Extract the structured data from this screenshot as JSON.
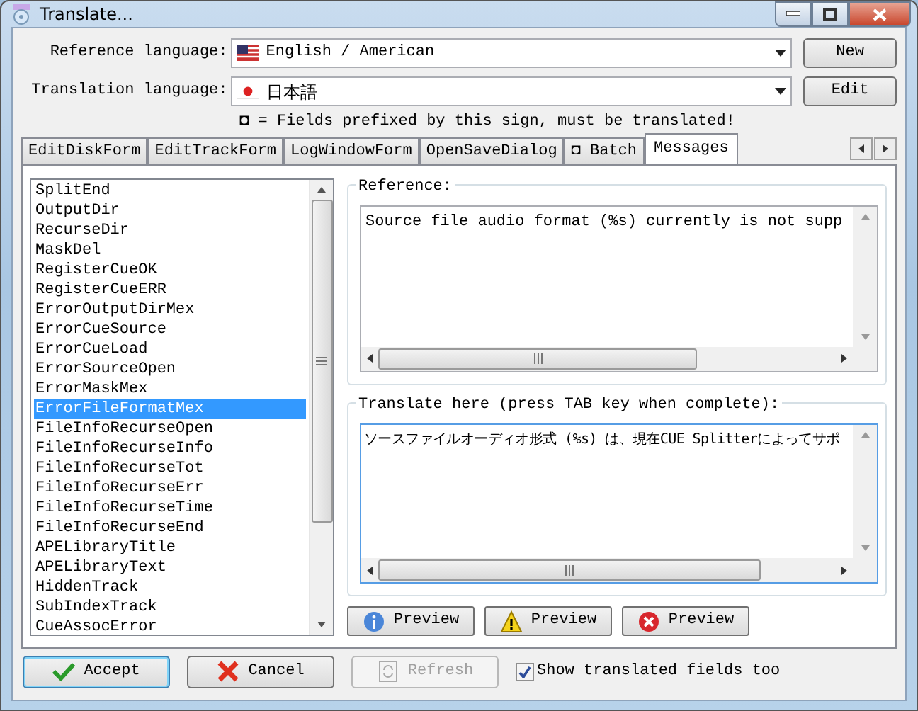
{
  "window": {
    "title": "Translate..."
  },
  "languages": [
    {
      "label": "Reference language:",
      "value": "English / American",
      "kind": "us"
    },
    {
      "label": "Translation language:",
      "value": "日本語",
      "kind": "jp"
    }
  ],
  "side_buttons": [
    "New",
    "Edit"
  ],
  "note": "◘ = Fields prefixed by this sign, must be translated!",
  "tabs": [
    {
      "label": "EditDiskForm",
      "selected": false
    },
    {
      "label": "EditTrackForm",
      "selected": false
    },
    {
      "label": "LogWindowForm",
      "selected": false
    },
    {
      "label": "OpenSaveDialog",
      "selected": false
    },
    {
      "label": "◘ Batch",
      "selected": false
    },
    {
      "label": "Messages",
      "selected": true
    }
  ],
  "keys": [
    {
      "label": "SplitEnd",
      "selected": false
    },
    {
      "label": "OutputDir",
      "selected": false
    },
    {
      "label": "RecurseDir",
      "selected": false
    },
    {
      "label": "MaskDel",
      "selected": false
    },
    {
      "label": "RegisterCueOK",
      "selected": false
    },
    {
      "label": "RegisterCueERR",
      "selected": false
    },
    {
      "label": "ErrorOutputDirMex",
      "selected": false
    },
    {
      "label": "ErrorCueSource",
      "selected": false
    },
    {
      "label": "ErrorCueLoad",
      "selected": false
    },
    {
      "label": "ErrorSourceOpen",
      "selected": false
    },
    {
      "label": "ErrorMaskMex",
      "selected": false
    },
    {
      "label": "ErrorFileFormatMex",
      "selected": true
    },
    {
      "label": "FileInfoRecurseOpen",
      "selected": false
    },
    {
      "label": "FileInfoRecurseInfo",
      "selected": false
    },
    {
      "label": "FileInfoRecurseTot",
      "selected": false
    },
    {
      "label": "FileInfoRecurseErr",
      "selected": false
    },
    {
      "label": "FileInfoRecurseTime",
      "selected": false
    },
    {
      "label": "FileInfoRecurseEnd",
      "selected": false
    },
    {
      "label": "APELibraryTitle",
      "selected": false
    },
    {
      "label": "APELibraryText",
      "selected": false
    },
    {
      "label": "HiddenTrack",
      "selected": false
    },
    {
      "label": "SubIndexTrack",
      "selected": false
    },
    {
      "label": "CueAssocError",
      "selected": false
    }
  ],
  "reference": {
    "label": "Reference:",
    "text": "Source file audio format (%s) currently is not supp"
  },
  "translation": {
    "label": "Translate here (press TAB key when complete):",
    "text": "ソースファイルオーディオ形式 (%s) は、現在CUE Splitterによってサポ"
  },
  "preview_buttons": [
    {
      "kind": "info",
      "label": "Preview"
    },
    {
      "kind": "warning",
      "label": "Preview"
    },
    {
      "kind": "error",
      "label": "Preview"
    }
  ],
  "footer_buttons": [
    {
      "kind": "accept",
      "label": "Accept",
      "disabled": false
    },
    {
      "kind": "cancel",
      "label": "Cancel",
      "disabled": false
    },
    {
      "kind": "refresh",
      "label": "Refresh",
      "disabled": true
    }
  ],
  "show_translated": {
    "label": "Show translated fields too",
    "checked": true
  }
}
